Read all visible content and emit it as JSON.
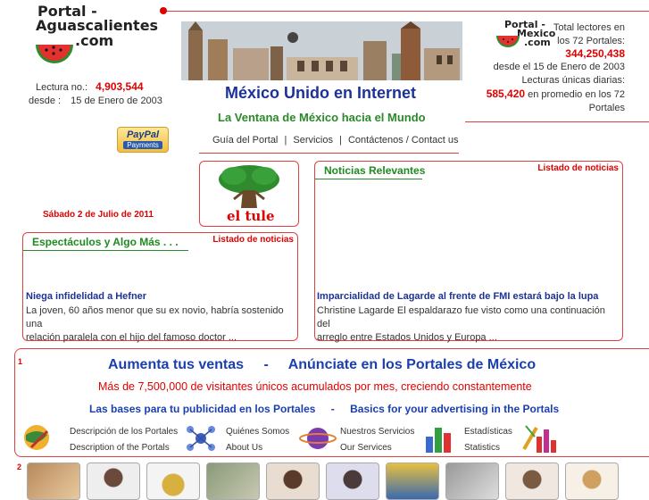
{
  "left_logo": {
    "line1": "Portal -",
    "line2": "Aguascalientes",
    "line3": ".com"
  },
  "counter": {
    "label": "Lectura no.:",
    "value": "4,903,544",
    "since_label": "desde :",
    "since_value": "15 de Enero de 2003"
  },
  "header": {
    "title": "México Unido en Internet",
    "tagline": "La Ventana de México hacia el Mundo"
  },
  "right_logo": {
    "line1": "Portal -",
    "line2": "Mexico",
    "line3": ".com"
  },
  "stats": {
    "total_label1": "Total lectores en",
    "total_label2": "los 72 Portales:",
    "total_value": "344,250,438",
    "since": "desde el 15 de Enero de 2003",
    "daily_label": "Lecturas únicas diarias:",
    "daily_value": "585,420",
    "daily_suffix": "en promedio en los 72",
    "daily_suffix2": "Portales"
  },
  "paypal": {
    "line1": "PayPal",
    "line2": "Payments"
  },
  "nav": {
    "item1": "Guía del Portal",
    "item2": "Servicios",
    "item3": "Contáctenos / Contact us",
    "sep": "|"
  },
  "tule_label": "el tule",
  "date": "Sábado 2 de Julio de 2011",
  "noticias": {
    "header": "Noticias Relevantes",
    "listado": "Listado de noticias",
    "title": "Imparcialidad de Lagarde al frente de FMI estará bajo la lupa",
    "line1": "Christine Lagarde El espaldarazo fue visto como una continuación del",
    "line2": "arreglo entre Estados Unidos y Europa ..."
  },
  "espectaculos": {
    "header": "Espectáculos y Algo Más . . .",
    "listado": "Listado de noticias",
    "title": "Niega infidelidad a Hefner",
    "line1": "La joven, 60 años menor que su ex novio, habría sostenido una",
    "line2": "relación paralela con el hijo del famoso doctor ..."
  },
  "ad": {
    "num1": "1",
    "num2": "2",
    "headline_a": "Aumenta tus ventas",
    "dash": "-",
    "headline_b": "Anúnciate en los Portales de México",
    "sub": "Más de 7,500,000 de visitantes únicos acumulados por mes, creciendo constantemente",
    "bases_es": "Las bases para tu publicidad en los Portales",
    "bases_dash": "-",
    "bases_en": "Basics for your advertising in the Portals",
    "links": [
      {
        "es": "Descripción de los Portales",
        "en": "Description of the Portals",
        "icon": "globe-icon"
      },
      {
        "es": "Quiénes Somos",
        "en": "About Us",
        "icon": "molecule-icon"
      },
      {
        "es": "Nuestros Servicios",
        "en": "Our Services",
        "icon": "planet-icon"
      },
      {
        "es": "Estadísticas",
        "en": "Statistics",
        "icon": "bar-chart-icon"
      }
    ]
  }
}
